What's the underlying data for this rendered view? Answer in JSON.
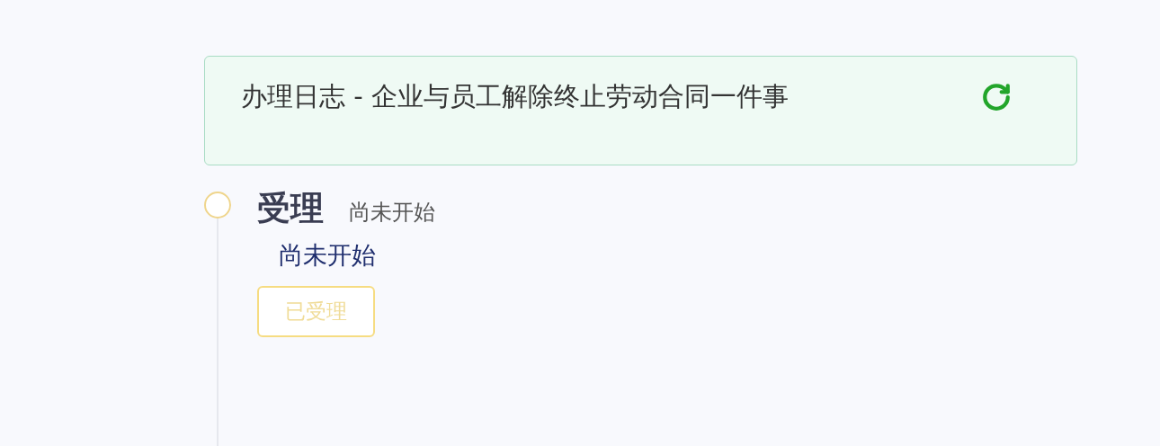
{
  "log_card": {
    "title": "办理日志 - 企业与员工解除终止劳动合同一件事"
  },
  "timeline": [
    {
      "title": "受理",
      "status": "尚未开始",
      "detail": "尚未开始",
      "button": {
        "label": "已受理",
        "disabled": true
      }
    }
  ]
}
